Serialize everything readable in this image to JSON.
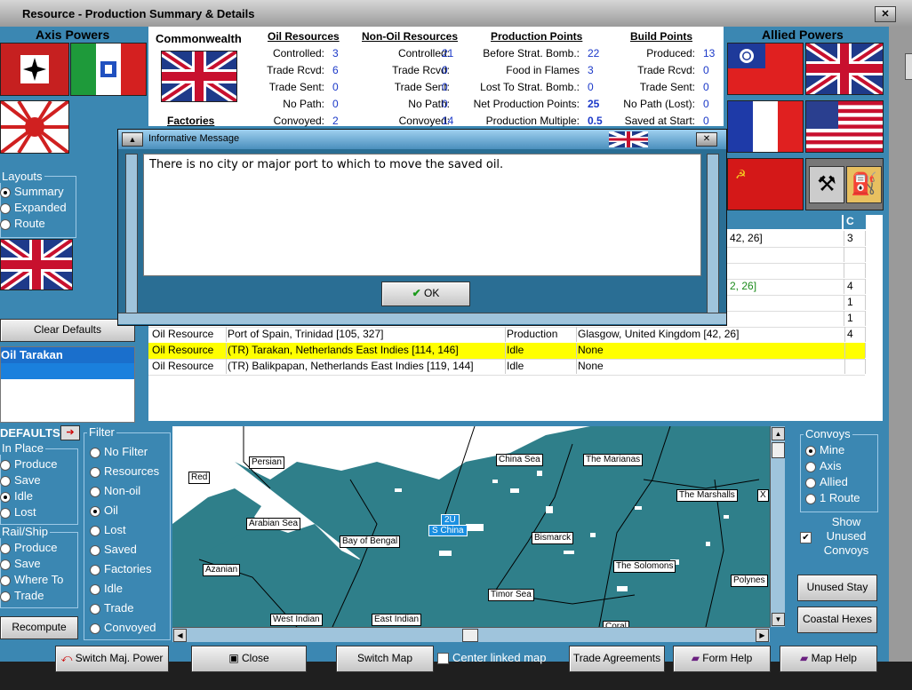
{
  "window": {
    "title": "Resource - Production Summary & Details"
  },
  "axis": {
    "header": "Axis Powers"
  },
  "allied": {
    "header": "Allied Powers"
  },
  "summary": {
    "country": "Commonwealth",
    "factories_label": "Factories",
    "oil": {
      "header": "Oil Resources",
      "rows": [
        {
          "label": "Controlled:",
          "value": "3"
        },
        {
          "label": "Trade Rcvd:",
          "value": "6"
        },
        {
          "label": "Trade Sent:",
          "value": "0"
        },
        {
          "label": "No Path:",
          "value": "0"
        },
        {
          "label": "Convoyed:",
          "value": "2"
        }
      ]
    },
    "nonoil": {
      "header": "Non-Oil Resources",
      "rows": [
        {
          "label": "Controlled:",
          "value": "21"
        },
        {
          "label": "Trade Rcvd:",
          "value": "0"
        },
        {
          "label": "Trade Sent:",
          "value": "0"
        },
        {
          "label": "No Path:",
          "value": "0"
        },
        {
          "label": "Convoyed:",
          "value": "14"
        }
      ]
    },
    "pp": {
      "header": "Production Points",
      "rows": [
        {
          "label": "Before Strat. Bomb.:",
          "value": "22"
        },
        {
          "label": "Food in Flames",
          "value": "3"
        },
        {
          "label": "Lost To Strat. Bomb.:",
          "value": "0"
        },
        {
          "label": "Net Production Points:",
          "value": "25"
        },
        {
          "label": "Production Multiple:",
          "value": "0.5"
        }
      ]
    },
    "bp": {
      "header": "Build Points",
      "rows": [
        {
          "label": "Produced:",
          "value": "13"
        },
        {
          "label": "Trade Rcvd:",
          "value": "0"
        },
        {
          "label": "Trade Sent:",
          "value": "0"
        },
        {
          "label": "No Path (Lost):",
          "value": "0"
        },
        {
          "label": "Saved at Start:",
          "value": "0"
        }
      ]
    }
  },
  "layouts": {
    "title": "Layouts",
    "options": [
      "Summary",
      "Expanded",
      "Route"
    ],
    "selected": "Summary"
  },
  "clear_defaults": "Clear Defaults",
  "selected_list": {
    "header": "Oil Tarakan"
  },
  "defaults": {
    "title": "DEFAULTS",
    "in_place": {
      "title": "In Place",
      "options": [
        "Produce",
        "Save",
        "Idle",
        "Lost"
      ],
      "selected": "Idle"
    },
    "rail_ship": {
      "title": "Rail/Ship",
      "options": [
        "Produce",
        "Save",
        "Where To",
        "Trade"
      ]
    }
  },
  "recompute": "Recompute",
  "filter": {
    "title": "Filter",
    "options": [
      "No Filter",
      "Resources",
      "Non-oil",
      "Oil",
      "Lost",
      "Saved",
      "Factories",
      "Idle",
      "Trade",
      "Convoyed"
    ],
    "selected": "Oil"
  },
  "table": {
    "header_c": "C",
    "partial_rows": [
      {
        "dest": "42, 26]",
        "c": "3",
        "green": false
      },
      {
        "dest": "",
        "c": "",
        "green": false
      },
      {
        "dest": "",
        "c": "",
        "green": false
      },
      {
        "dest": "2, 26]",
        "c": "4",
        "green": true
      },
      {
        "dest": "",
        "c": "1",
        "green": false
      },
      {
        "dest": "",
        "c": "1",
        "green": false
      }
    ],
    "rows": [
      {
        "type": "Oil Resource",
        "location": "Port of Spain, Trinidad [105, 327]",
        "status": "Production",
        "dest": "Glasgow, United Kingdom [42, 26]",
        "c": "4",
        "highlight": false
      },
      {
        "type": "Oil Resource",
        "location": "(TR) Tarakan, Netherlands East Indies [114, 146]",
        "status": "Idle",
        "dest": "None",
        "c": "",
        "highlight": true
      },
      {
        "type": "Oil Resource",
        "location": "(TR) Balikpapan, Netherlands East Indies [119, 144]",
        "status": "Idle",
        "dest": "None",
        "c": "",
        "highlight": false
      }
    ]
  },
  "map": {
    "labels": [
      "Persian",
      "Red",
      "Arabian Sea",
      "Bay of Bengal",
      "Azanian",
      "West Indian",
      "East Indian",
      "China Sea",
      "The Marianas",
      "The Marshalls",
      "Bismarck",
      "The Solomons",
      "Timor Sea",
      "Polynes",
      "Coral",
      "X"
    ],
    "unit_count": "2U",
    "unit_label": "S China"
  },
  "convoys": {
    "title": "Convoys",
    "options": [
      "Mine",
      "Axis",
      "Allied",
      "1 Route"
    ],
    "selected": "Mine"
  },
  "show_unused": {
    "label": "Show Unused Convoys",
    "checked": true
  },
  "unused_stay": "Unused Stay",
  "coastal_hexes": "Coastal Hexes",
  "bottom": {
    "switch_power": "Switch Maj. Power",
    "close": "Close",
    "switch_map": "Switch Map",
    "center_linked": "Center linked map",
    "trade_agreements": "Trade Agreements",
    "form_help": "Form Help",
    "map_help": "Map Help"
  },
  "dialog": {
    "title": "Informative Message",
    "message": "There is no city or major port to which to move the saved oil.",
    "ok": "OK"
  },
  "colors": {
    "panel": "#3b87b2",
    "highlight": "#ffff00",
    "link": "#1a38c8",
    "sea": "#2f7f8a"
  }
}
